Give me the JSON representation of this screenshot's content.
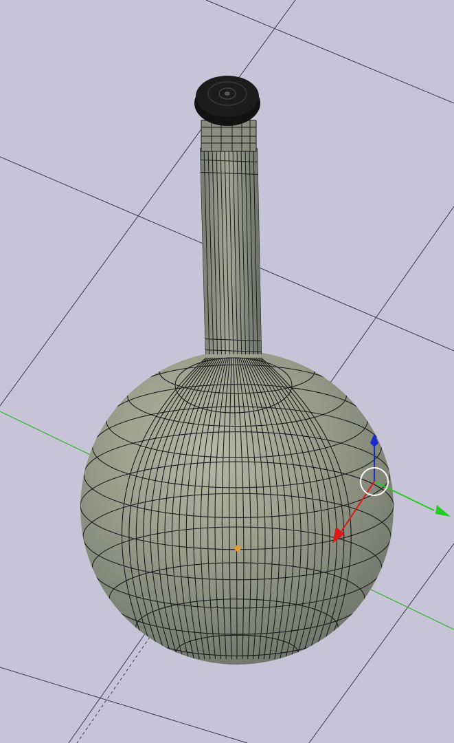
{
  "viewport": {
    "background_color": "#c8c4d8",
    "grid_line_color": "#3c3a46",
    "x_axis_color": "#2db22d",
    "model_body_color": "#9a9c8c",
    "wire_color": "#1a1a1a",
    "cap_color": "#0f0f0f",
    "origin_marker_color": "#e89a30"
  },
  "gizmo": {
    "z_arrow_color": "#1a2ccc",
    "y_arrow_color": "#22cc22",
    "x_arrow_color": "#dd1a1a",
    "rotate_ring_color": "#ffffff",
    "icons": [
      "z-axis-arrow-icon",
      "y-axis-arrow-icon",
      "x-axis-arrow-icon",
      "rotate-ring-icon"
    ]
  }
}
